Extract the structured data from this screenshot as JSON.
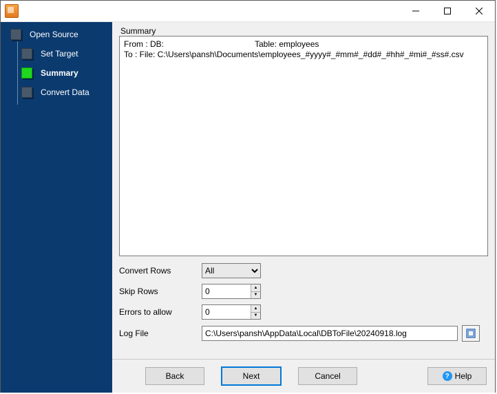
{
  "window": {
    "title": ""
  },
  "sidebar": {
    "items": [
      {
        "label": "Open Source",
        "active": false
      },
      {
        "label": "Set Target",
        "active": false
      },
      {
        "label": "Summary",
        "active": true
      },
      {
        "label": "Convert Data",
        "active": false
      }
    ]
  },
  "summary": {
    "heading": "Summary",
    "from_label": "From : DB:",
    "from_table_label": "Table: employees",
    "to_line": "To : File: C:\\Users\\pansh\\Documents\\employees_#yyyy#_#mm#_#dd#_#hh#_#mi#_#ss#.csv"
  },
  "form": {
    "convert_rows": {
      "label": "Convert Rows",
      "value": "All",
      "options": [
        "All"
      ]
    },
    "skip_rows": {
      "label": "Skip Rows",
      "value": "0"
    },
    "errors_allow": {
      "label": "Errors to allow",
      "value": "0"
    },
    "log_file": {
      "label": "Log File",
      "value": "C:\\Users\\pansh\\AppData\\Local\\DBToFile\\20240918.log"
    }
  },
  "buttons": {
    "back": "Back",
    "next": "Next",
    "cancel": "Cancel",
    "help": "Help"
  }
}
